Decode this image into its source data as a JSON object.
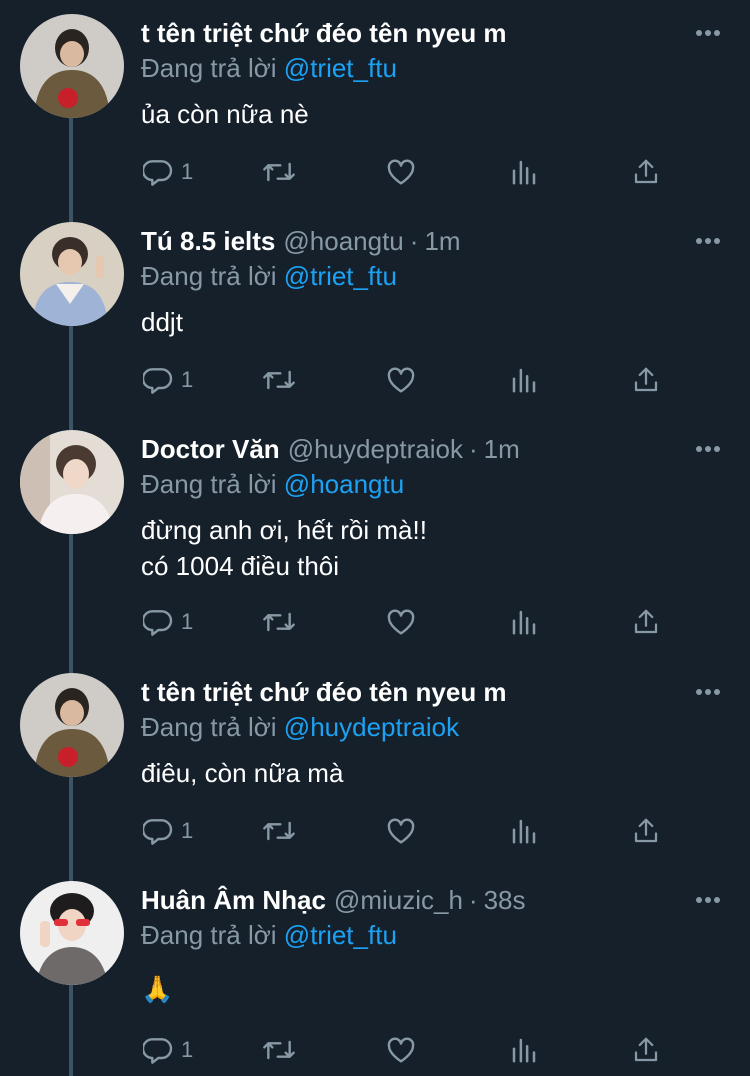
{
  "reply_prefix": "Đang trả lời",
  "colors": {
    "background": "#15202b",
    "secondary_text": "#8899a6",
    "accent": "#1da1f2",
    "thread_line": "#3d5466"
  },
  "icons": {
    "reply": "reply-icon",
    "retweet": "retweet-icon",
    "like": "heart-icon",
    "analytics": "analytics-icon",
    "share": "share-icon",
    "more": "more-dots-icon"
  },
  "tweets": [
    {
      "name": "t tên triệt chứ đéo tên nyeu m",
      "handle": "",
      "separator": "",
      "time": "",
      "reply_to": "@triet_ftu",
      "text_lines": [
        "ủa còn nữa nè"
      ],
      "reply_count": "1"
    },
    {
      "name": "Tú 8.5 ielts",
      "handle": "@hoangtu",
      "separator": "·",
      "time": "1m",
      "reply_to": "@triet_ftu",
      "text_lines": [
        "ddjt"
      ],
      "reply_count": "1"
    },
    {
      "name": "Doctor Văn",
      "handle": "@huydeptraiok",
      "separator": "·",
      "time": "1m",
      "reply_to": "@hoangtu",
      "text_lines": [
        "đừng anh ơi, hết rồi mà!!",
        "có 1004 điều thôi"
      ],
      "reply_count": "1"
    },
    {
      "name": "t tên triệt chứ đéo tên nyeu m",
      "handle": "",
      "separator": "",
      "time": "",
      "reply_to": "@huydeptraiok",
      "text_lines": [
        "điêu, còn nữa mà"
      ],
      "reply_count": "1"
    },
    {
      "name": "Huân Âm Nhạc",
      "handle": "@miuzic_h",
      "separator": "·",
      "time": "38s",
      "reply_to": "@triet_ftu",
      "text_lines": [
        "🙏"
      ],
      "reply_count": "1"
    }
  ]
}
